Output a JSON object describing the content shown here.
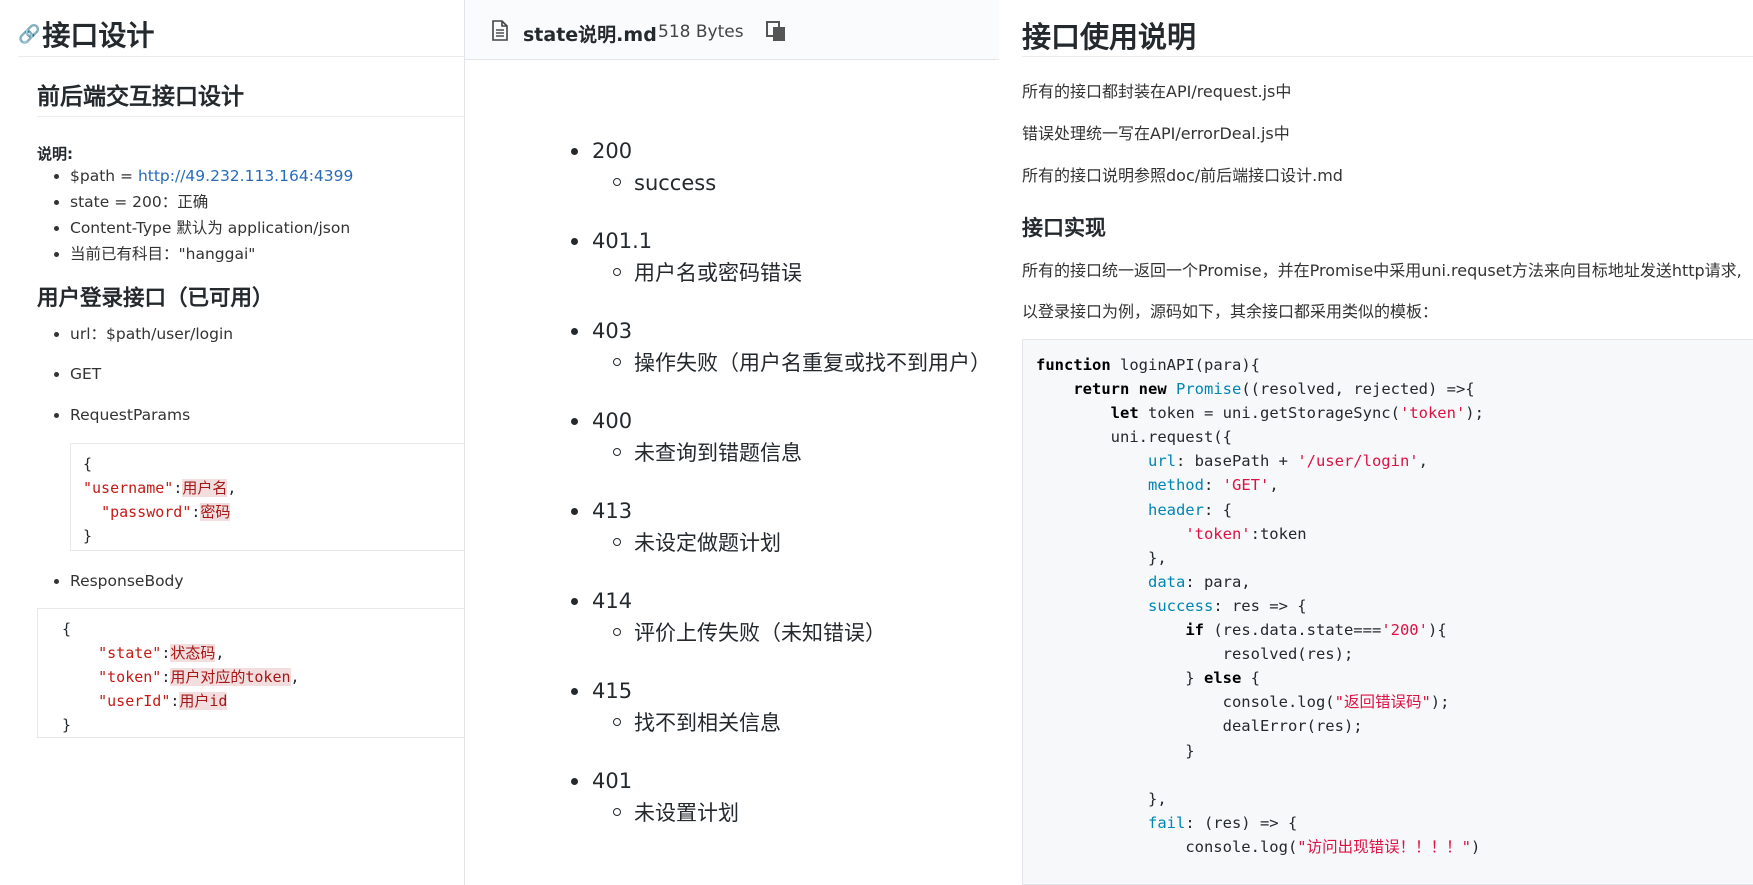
{
  "left": {
    "title": "接口设计",
    "section1_title": "前后端交互接口设计",
    "note_label": "说明:",
    "notes": [
      {
        "prefix": "$path = ",
        "link": "http://49.232.113.164:4399"
      },
      {
        "text": "state = 200：正确"
      },
      {
        "text": "Content-Type 默认为 application/json"
      },
      {
        "text": "当前已有科目：\"hanggai\""
      }
    ],
    "section2_title": "用户登录接口（已可用）",
    "api_items": [
      "url：$path/user/login",
      "GET",
      "RequestParams",
      "ResponseBody"
    ],
    "request_params": {
      "open": "{",
      "username_key": "\"username\"",
      "username_val": "用户名",
      "password_key": "\"password\"",
      "password_val": "密码",
      "close": "}"
    },
    "response_body": {
      "open": "{",
      "state_key": "\"state\"",
      "state_val": "状态码",
      "token_key": "\"token\"",
      "token_val": "用户对应的token",
      "userid_key": "\"userId\"",
      "userid_val": "用户id",
      "close": "}"
    }
  },
  "middle": {
    "file_name": "state说明.md",
    "file_size": "518 Bytes",
    "states": [
      {
        "code": "200",
        "desc": "success"
      },
      {
        "code": "401.1",
        "desc": "用户名或密码错误"
      },
      {
        "code": "403",
        "desc": "操作失败（用户名重复或找不到用户）"
      },
      {
        "code": "400",
        "desc": "未查询到错题信息"
      },
      {
        "code": "413",
        "desc": "未设定做题计划"
      },
      {
        "code": "414",
        "desc": "评价上传失败（未知错误）"
      },
      {
        "code": "415",
        "desc": "找不到相关信息"
      },
      {
        "code": "401",
        "desc": "未设置计划"
      }
    ]
  },
  "right": {
    "title": "接口使用说明",
    "paragraphs": [
      "所有的接口都封装在API/request.js中",
      "错误处理统一写在API/errorDeal.js中",
      "所有的接口说明参照doc/前后端接口设计.md"
    ],
    "impl_title": "接口实现",
    "impl_paragraphs": [
      "所有的接口统一返回一个Promise，并在Promise中采用uni.requset方法来向目标地址发送http请求,",
      "以登录接口为例，源码如下，其余接口都采用类似的模板："
    ],
    "code": {
      "fn_name": "loginAPI",
      "fn_params": "(para){",
      "promise_class": "Promise",
      "promise_args": "((resolved, rejected) =>{",
      "token_decl": "token = uni.getStorageSync(",
      "token_str": "'token'",
      "token_end": ");",
      "request_open": "uni.request({",
      "url_key": "url",
      "url_expr": ": basePath + ",
      "url_str": "'/user/login'",
      "method_key": "method",
      "method_str": "'GET'",
      "header_key": "header",
      "header_token_str": "'token'",
      "header_token_val": ":token",
      "data_key": "data",
      "data_val": ": para,",
      "success_key": "success",
      "success_args": ": res => {",
      "if_cond": "(res.data.state===",
      "if_str": "'200'",
      "resolved_call": "resolved(res);",
      "console_log_open": "console.log(",
      "error_code_str": "\"返回错误码\"",
      "deal_error": "dealError(res);",
      "fail_key": "fail",
      "fail_args": ": (res) => {",
      "visit_error_str": "\"访问出现错误！！！！\""
    }
  }
}
